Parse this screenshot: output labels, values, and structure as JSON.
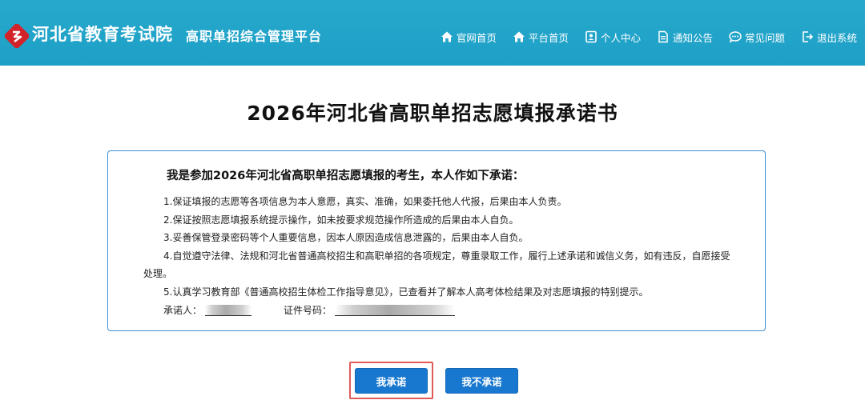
{
  "header": {
    "org_name": "河北省教育考试院",
    "platform_name": "高职单招综合管理平台",
    "nav": [
      {
        "label": "官网首页",
        "icon": "home-icon"
      },
      {
        "label": "平台首页",
        "icon": "home-icon"
      },
      {
        "label": "个人中心",
        "icon": "user-card-icon"
      },
      {
        "label": "通知公告",
        "icon": "document-icon"
      },
      {
        "label": "常见问题",
        "icon": "chat-icon"
      },
      {
        "label": "退出系统",
        "icon": "logout-icon"
      }
    ]
  },
  "page": {
    "title": "2026年河北省高职单招志愿填报承诺书"
  },
  "pledge": {
    "heading": "我是参加2026年河北省高职单招志愿填报的考生，本人作如下承诺：",
    "items": [
      "1.保证填报的志愿等各项信息为本人意愿，真实、准确，如果委托他人代报，后果由本人负责。",
      "2.保证按照志愿填报系统提示操作，如未按要求规范操作所造成的后果由本人自负。",
      "3.妥善保管登录密码等个人重要信息，因本人原因造成信息泄露的，后果由本人自负。",
      "4.自觉遵守法律、法规和河北省普通高校招生和高职单招的各项规定，尊重录取工作，履行上述承诺和诚信义务，如有违反，自愿接受处理。",
      "5.认真学习教育部《普通高校招生体检工作指导意见》，已查看并了解本人高考体检结果及对志愿填报的特别提示。"
    ],
    "signer_label": "承诺人：",
    "id_label": "证件号码："
  },
  "buttons": {
    "agree": "我承诺",
    "disagree": "我不承诺"
  },
  "colors": {
    "header_bg": "#1e9fc6",
    "button_bg": "#1878d0",
    "highlight_border": "#e05a5a",
    "box_border": "#3b8fd4"
  }
}
